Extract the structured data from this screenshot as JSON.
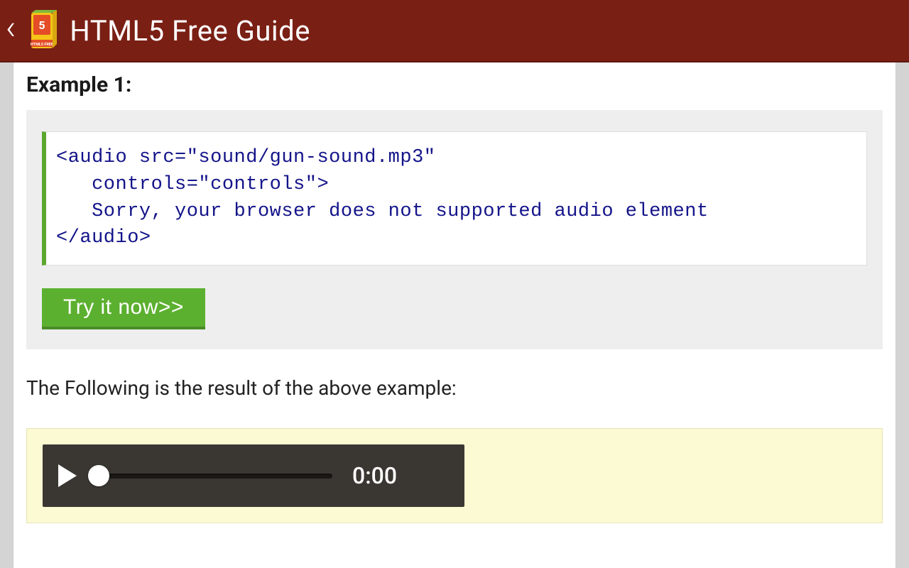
{
  "header": {
    "title": "HTML5 Free Guide",
    "logo_badge": "HTML5 FREE"
  },
  "example": {
    "heading": "Example 1:",
    "code": "<audio src=\"sound/gun-sound.mp3\"\n   controls=\"controls\">\n   Sorry, your browser does not supported audio element\n</audio>",
    "try_button": "Try it now>>",
    "result_intro": "The Following is the result of the above example:"
  },
  "audio_player": {
    "time": "0:00"
  }
}
